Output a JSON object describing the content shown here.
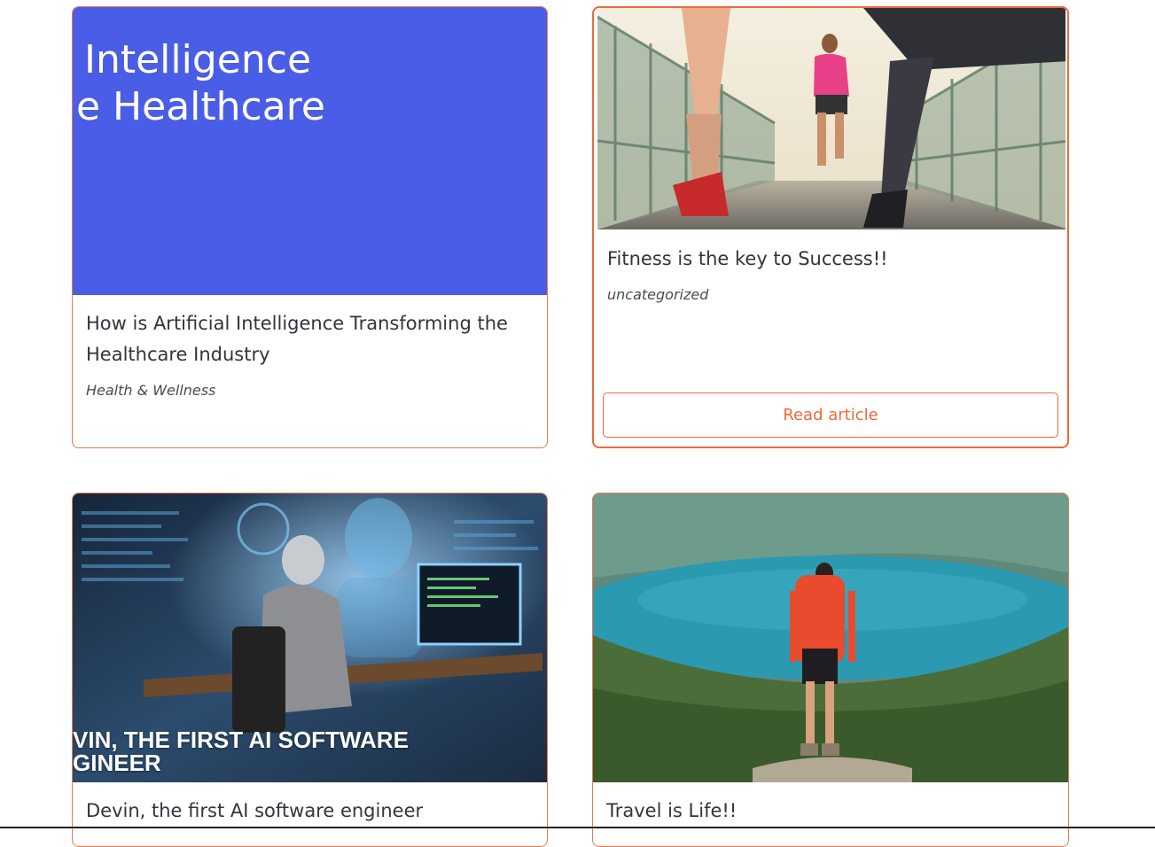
{
  "colors": {
    "accent": "#ee6a3a",
    "ai_banner_bg": "#4a5de6",
    "text": "#33343d"
  },
  "cards": [
    {
      "title": "How is Artificial Intelligence Transforming the Healthcare Industry",
      "category": "Health & Wellness",
      "image_text": [
        "Intelligence",
        "e Healthcare"
      ]
    },
    {
      "title": "Fitness is the key to Success!!",
      "category": "uncategorized",
      "button_label": "Read article"
    },
    {
      "title": "Devin, the first AI software engineer",
      "image_text": [
        "VIN, THE FIRST AI SOFTWARE",
        "GINEER"
      ]
    },
    {
      "title": "Travel is Life!!"
    }
  ]
}
